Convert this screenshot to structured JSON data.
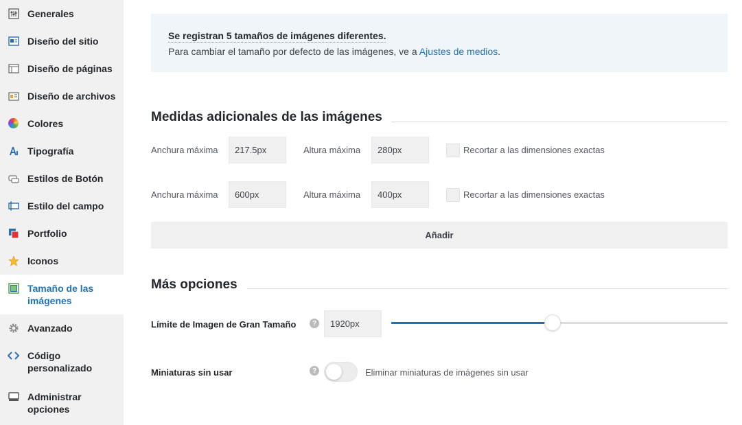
{
  "sidebar": {
    "items": [
      {
        "label": "Generales",
        "icon": "sliders-icon"
      },
      {
        "label": "Diseño del sitio",
        "icon": "site-layout-icon"
      },
      {
        "label": "Diseño de páginas",
        "icon": "page-layout-icon"
      },
      {
        "label": "Diseño de archivos",
        "icon": "archive-layout-icon"
      },
      {
        "label": "Colores",
        "icon": "color-wheel-icon"
      },
      {
        "label": "Tipografía",
        "icon": "typography-icon"
      },
      {
        "label": "Estilos de Botón",
        "icon": "button-icon"
      },
      {
        "label": "Estilo del campo",
        "icon": "field-icon"
      },
      {
        "label": "Portfolio",
        "icon": "portfolio-icon"
      },
      {
        "label": "Iconos",
        "icon": "star-icon"
      },
      {
        "label": "Tamaño de las imágenes",
        "label_line1": "Tamaño de las",
        "label_line2": "imágenes",
        "icon": "image-size-icon",
        "active": true
      },
      {
        "label": "Avanzado",
        "icon": "gear-icon"
      },
      {
        "label": "Código personalizado",
        "label_line1": "Código",
        "label_line2": "personalizado",
        "icon": "code-icon"
      },
      {
        "label": "Administrar opciones",
        "label_line1": "Administrar",
        "label_line2": "opciones",
        "icon": "admin-icon"
      }
    ]
  },
  "notice": {
    "line1": "Se registran 5 tamaños de imágenes diferentes.",
    "line2_prefix": "Para cambiar el tamaño por defecto de las imágenes, ve a ",
    "line2_link": "Ajustes de medios",
    "line2_suffix": "."
  },
  "sizes_section": {
    "title": "Medidas adicionales de las imágenes",
    "rows": [
      {
        "width_label": "Anchura máxima",
        "width_value": "217.5px",
        "height_label": "Altura máxima",
        "height_value": "280px",
        "crop_label": "Recortar a las dimensiones exactas",
        "crop_checked": false
      },
      {
        "width_label": "Anchura máxima",
        "width_value": "600px",
        "height_label": "Altura máxima",
        "height_value": "400px",
        "crop_label": "Recortar a las dimensiones exactas",
        "crop_checked": false
      }
    ],
    "add_button": "Añadir"
  },
  "more_options": {
    "title": "Más opciones",
    "big_image": {
      "label": "Límite de Imagen de Gran Tamaño",
      "value": "1920px",
      "slider_fraction": 0.48
    },
    "unused_thumbs": {
      "label": "Miniaturas sin usar",
      "toggle_label": "Eliminar miniaturas de imágenes sin usar",
      "enabled": false
    }
  },
  "colors": {
    "accent": "#2271b1",
    "sidebar_bg": "#f1f1f1",
    "notice_bg": "#f0f5fa"
  }
}
